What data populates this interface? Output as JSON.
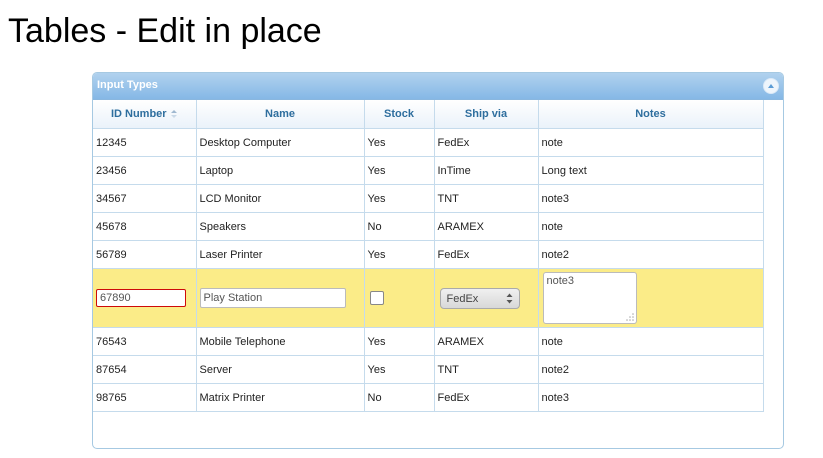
{
  "page": {
    "title": "Tables - Edit in place"
  },
  "grid": {
    "caption": "Input Types",
    "columns": [
      "ID Number",
      "Name",
      "Stock",
      "Ship via",
      "Notes"
    ],
    "sort_column": "ID Number",
    "rows_before_edit": [
      {
        "id": "12345",
        "name": "Desktop Computer",
        "stock": "Yes",
        "ship": "FedEx",
        "notes": "note"
      },
      {
        "id": "23456",
        "name": "Laptop",
        "stock": "Yes",
        "ship": "InTime",
        "notes": "Long text"
      },
      {
        "id": "34567",
        "name": "LCD Monitor",
        "stock": "Yes",
        "ship": "TNT",
        "notes": "note3"
      },
      {
        "id": "45678",
        "name": "Speakers",
        "stock": "No",
        "ship": "ARAMEX",
        "notes": "note"
      },
      {
        "id": "56789",
        "name": "Laser Printer",
        "stock": "Yes",
        "ship": "FedEx",
        "notes": "note2"
      }
    ],
    "edit_row": {
      "id": "67890",
      "name": "Play Station",
      "stock_checked": false,
      "ship": "FedEx",
      "notes": "note3"
    },
    "rows_after_edit": [
      {
        "id": "76543",
        "name": "Mobile Telephone",
        "stock": "Yes",
        "ship": "ARAMEX",
        "notes": "note"
      },
      {
        "id": "87654",
        "name": "Server",
        "stock": "Yes",
        "ship": "TNT",
        "notes": "note2"
      },
      {
        "id": "98765",
        "name": "Matrix Printer",
        "stock": "No",
        "ship": "FedEx",
        "notes": "note3"
      }
    ]
  },
  "colors": {
    "header_text": "#2e6e9e",
    "caption_bg": "#85b8e6",
    "edit_row_bg": "#fbec88",
    "error_border": "#cd0a0a"
  },
  "icons": {
    "collapse": "circle-triangle-up-icon",
    "sort": "sort-arrows-icon",
    "resize": "resize-grip-icon"
  }
}
